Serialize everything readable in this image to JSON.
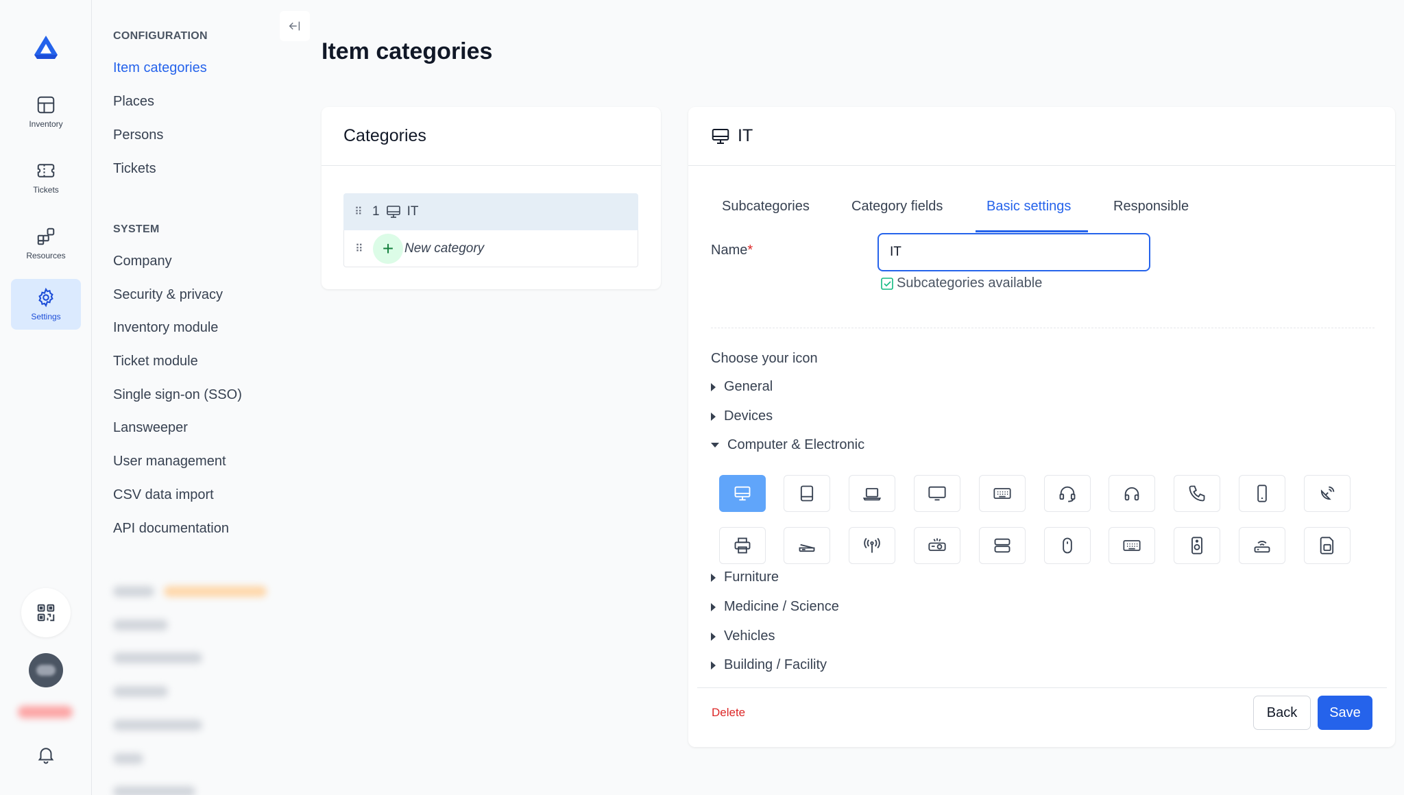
{
  "rail": {
    "items": [
      {
        "label": "Inventory",
        "icon": "grid-icon"
      },
      {
        "label": "Tickets",
        "icon": "ticket-icon"
      },
      {
        "label": "Resources",
        "icon": "blocks-icon"
      },
      {
        "label": "Settings",
        "icon": "gear-icon",
        "active": true
      }
    ]
  },
  "nav": {
    "config_heading": "CONFIGURATION",
    "config_items": [
      "Item categories",
      "Places",
      "Persons",
      "Tickets"
    ],
    "system_heading": "SYSTEM",
    "system_items": [
      "Company",
      "Security & privacy",
      "Inventory module",
      "Ticket module",
      "Single sign-on (SSO)",
      "Lansweeper",
      "User management",
      "CSV data import",
      "API documentation"
    ]
  },
  "page": {
    "title": "Item categories"
  },
  "categories_card": {
    "title": "Categories",
    "rows": [
      {
        "number": "1",
        "label": "IT"
      }
    ],
    "new_label": "New category"
  },
  "detail": {
    "title": "IT",
    "tabs": [
      "Subcategories",
      "Category fields",
      "Basic settings",
      "Responsible"
    ],
    "active_tab": "Basic settings",
    "name_label": "Name",
    "name_value": "IT",
    "subcategories_label": "Subcategories available",
    "choose_icon_label": "Choose your icon",
    "groups": [
      "General",
      "Devices",
      "Computer & Electronic",
      "Furniture",
      "Medicine / Science",
      "Vehicles",
      "Building / Facility"
    ],
    "expanded_group": "Computer & Electronic",
    "icons": [
      "monitor-icon",
      "tablet-icon",
      "laptop-icon",
      "display-icon",
      "keyboard-icon",
      "headset-icon",
      "headphones-icon",
      "phone-icon",
      "mobile-icon",
      "satellite-dish-icon",
      "printer-icon",
      "scanner-icon",
      "antenna-icon",
      "projector-icon",
      "server-icon",
      "mouse-icon",
      "keyboard-alt-icon",
      "speaker-icon",
      "router-icon",
      "sim-card-icon"
    ],
    "selected_icon": "monitor-icon",
    "delete_label": "Delete",
    "back_label": "Back",
    "save_label": "Save"
  },
  "colors": {
    "accent": "#2563eb",
    "selected_icon_bg": "#60a5fa",
    "danger": "#dc2626"
  }
}
